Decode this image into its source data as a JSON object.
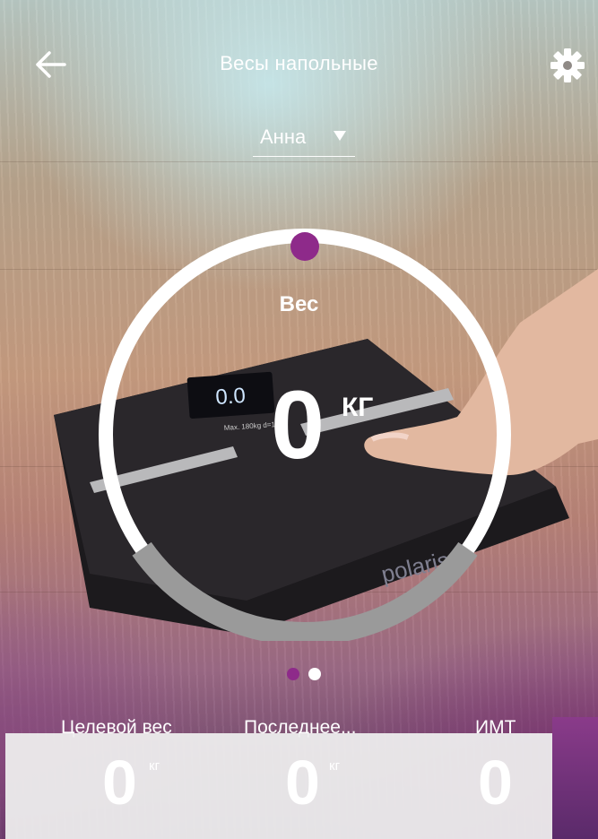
{
  "header": {
    "title": "Весы напольные",
    "back_icon": "arrow-left-icon",
    "settings_icon": "gear-icon"
  },
  "user_selector": {
    "selected": "Анна"
  },
  "gauge": {
    "label": "Вес",
    "value": "0",
    "unit": "КГ",
    "accent_color": "#8e2a8a",
    "track_color": "#ffffff",
    "base_color": "#9a9a9a"
  },
  "scale_device": {
    "display": "0.0",
    "brand": "polaris",
    "caption": "Max. 180kg  d=100g"
  },
  "pager": {
    "count": 2,
    "active": 0
  },
  "stats": [
    {
      "label": "Целевой вес",
      "value": "0",
      "unit": "кг"
    },
    {
      "label": "Последнее...",
      "value": "0",
      "unit": "кг"
    },
    {
      "label": "ИМТ",
      "value": "0",
      "unit": ""
    }
  ]
}
